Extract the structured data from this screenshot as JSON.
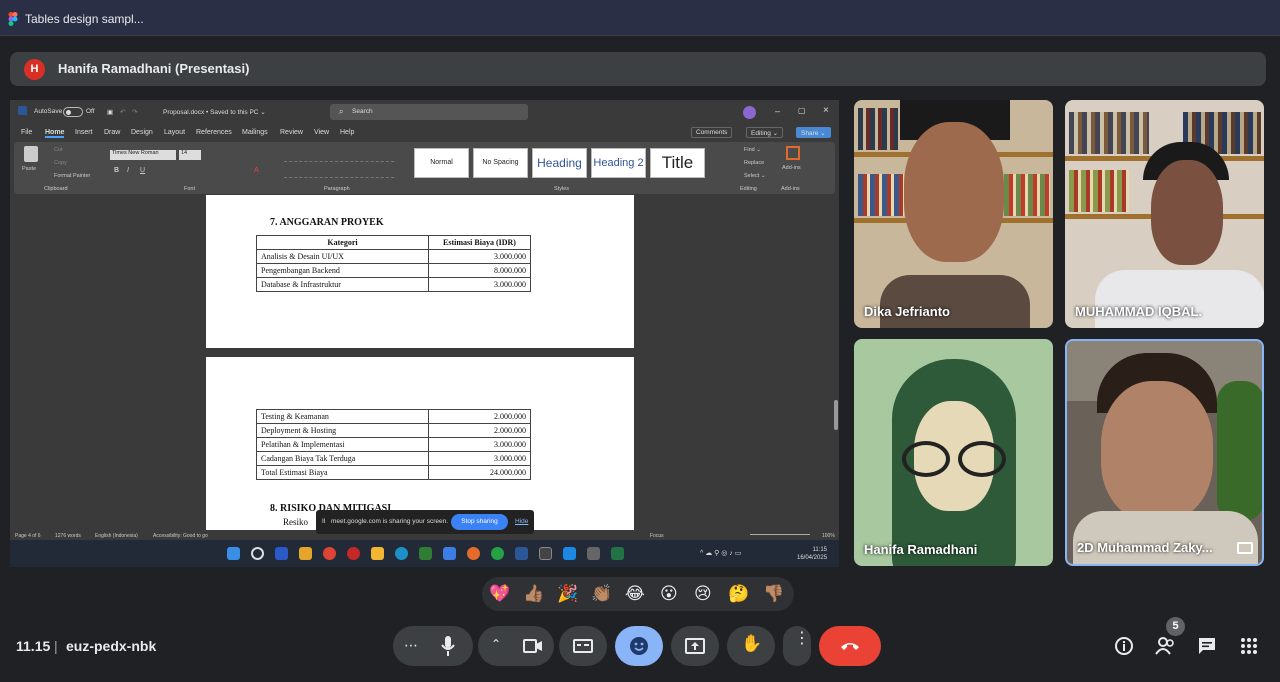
{
  "tab": {
    "title": "Tables design sampl..."
  },
  "presenter": {
    "initial": "H",
    "name": "Hanifa Ramadhani (Presentasi)"
  },
  "word": {
    "autosave": "AutoSave",
    "autosave_state": "Off",
    "filename": "Proposal.docx • Saved to this PC ⌄",
    "search": "Search",
    "user_initials": "HR",
    "menus": [
      "File",
      "Home",
      "Insert",
      "Draw",
      "Design",
      "Layout",
      "References",
      "Mailings",
      "Review",
      "View",
      "Help"
    ],
    "comments": "Comments",
    "editing": "Editing ⌄",
    "share": "Share ⌄",
    "ribbon": {
      "paste": "Paste",
      "cut": "Cut",
      "copy": "Copy",
      "format_painter": "Format Painter",
      "font": "Times New Roman",
      "size": "14",
      "groups": [
        "Clipboard",
        "Font",
        "Paragraph",
        "Styles",
        "Editing",
        "Add-ins"
      ],
      "styles": [
        "Normal",
        "No Spacing",
        "Heading",
        "Heading 2",
        "Title"
      ],
      "find": "Find ⌄",
      "replace": "Replace",
      "select": "Select ⌄",
      "addins": "Add-ins"
    },
    "doc": {
      "heading7": "7.  ANGGARAN PROYEK",
      "table_headers": [
        "Kategori",
        "Estimasi Biaya (IDR)"
      ],
      "rows_page1": [
        [
          "Analisis & Desain UI/UX",
          "3.000.000"
        ],
        [
          "Pengembangan Backend",
          "8.000.000"
        ],
        [
          "Database & Infrastruktur",
          "3.000.000"
        ]
      ],
      "rows_page2": [
        [
          "Testing & Keamanan",
          "2.000.000"
        ],
        [
          "Deployment & Hosting",
          "2.000.000"
        ],
        [
          "Pelatihan & Implementasi",
          "3.000.000"
        ],
        [
          "Cadangan Biaya Tak Terduga",
          "3.000.000"
        ],
        [
          "Total Estimasi Biaya",
          "24.000.000"
        ]
      ],
      "heading8": "8.  RISIKO DAN MITIGASI",
      "body_start": "Resiko"
    },
    "status": {
      "page": "Page 4 of 6",
      "words": "1276 words",
      "lang": "English (Indonesia)",
      "access": "Accessibility: Good to go",
      "focus": "Focus",
      "zoom": "100%"
    },
    "sharebar": {
      "text": "meet.google.com is sharing your screen.",
      "stop": "Stop sharing",
      "hide": "Hide"
    },
    "clock": {
      "time": "11:15",
      "date": "16/04/2025"
    }
  },
  "participants": [
    {
      "name": "Dika Jefrianto"
    },
    {
      "name": "MUHAMMAD IQBAL."
    },
    {
      "name": "Hanifa Ramadhani"
    },
    {
      "name": "2D Muhammad Zaky..."
    }
  ],
  "reactions": [
    "💖",
    "👍🏽",
    "🎉",
    "👏🏽",
    "😂",
    "😮",
    "😢",
    "🤔",
    "👎🏽"
  ],
  "meeting": {
    "time": "11.15",
    "separator": "|",
    "code": "euz-pedx-nbk",
    "participant_count": "5"
  },
  "colors": {
    "end_call": "#ea4335",
    "reaction_active": "#8ab4f8",
    "presenter_avatar": "#d93025"
  }
}
